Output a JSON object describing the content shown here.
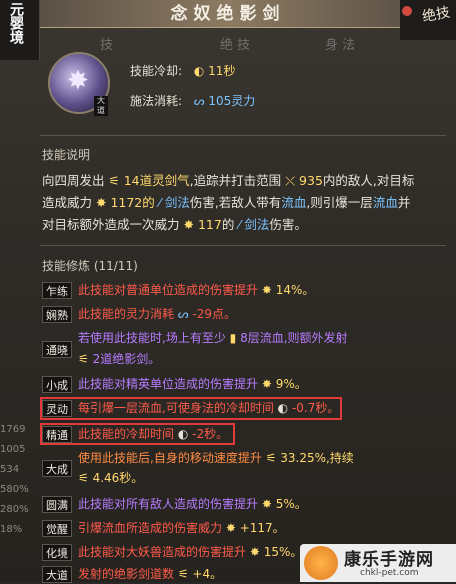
{
  "left_bar": {
    "text": "元婴境"
  },
  "header": {
    "title": "念奴绝影剑"
  },
  "corner": {
    "text": "绝技"
  },
  "bg_tabs": [
    "技",
    "绝 技",
    "身 法"
  ],
  "skill": {
    "icon_tag": "大道",
    "cooldown_label": "技能冷却:",
    "cooldown_value": "11秒",
    "cost_label": "施法消耗:",
    "cost_value": "105灵力"
  },
  "desc_section": {
    "title": "技能说明"
  },
  "description": {
    "p1": "向四周发出",
    "n1": "14道灵剑气",
    "p2": ",追踪并打击范围",
    "n2": "935",
    "p3": "内的敌人,对目标造成威力",
    "n3": "1172的",
    "n4": "剑法",
    "p4": "伤害,若敌人带有",
    "n5": "流血",
    "p5": ",则引爆一层",
    "n6": "流血",
    "p6": "并对目标额外造成一次威力",
    "n7": "117",
    "p7": "的",
    "n8": "剑法",
    "p8": "伤害。"
  },
  "training": {
    "title": "技能修炼 (11/11)",
    "rows": [
      {
        "tag": "乍练",
        "text": "此技能对普通单位造成的伤害提升",
        "value": "14%。"
      },
      {
        "tag": "娴熟",
        "text": "此技能的灵力消耗",
        "value": "-29点。"
      },
      {
        "tag": "通晓",
        "text": "若使用此技能时,场上有至少",
        "value": "8层流血,则额外发射",
        "text2": "2道绝影剑。"
      },
      {
        "tag": "小成",
        "text": "此技能对精英单位造成的伤害提升",
        "value": "9%。"
      },
      {
        "tag": "灵动",
        "text": "每引爆一层流血,可使身法的冷却时间",
        "value": "-0.7秒。"
      },
      {
        "tag": "精通",
        "text": "此技能的冷却时间",
        "value": "-2秒。"
      },
      {
        "tag": "大成",
        "text": "使用此技能后,自身的移动速度提升",
        "value": "33.25%,持续",
        "text2": "4.46秒。"
      },
      {
        "tag": "圆满",
        "text": "此技能对所有敌人造成的伤害提升",
        "value": "5%。"
      },
      {
        "tag": "觉醒",
        "text": "引爆流血所造成的伤害威力",
        "value": "+117。"
      },
      {
        "tag": "化境",
        "text": "此技能对大妖兽造成的伤害提升",
        "value": "15%。"
      },
      {
        "tag": "大道",
        "text": "发射的绝影剑道数",
        "value": "+4。"
      }
    ]
  },
  "side_stats": [
    "1769",
    "1005",
    "534",
    "580%",
    "280%",
    "18%"
  ],
  "watermark": {
    "title": "康乐手游网",
    "url": "chkl-pet.com"
  },
  "colors": {
    "highlight_border": "#e23a3a",
    "gold": "#ffd96b",
    "red": "#ff5a4a",
    "green": "#a8e36c",
    "blue": "#7cc4ff"
  }
}
